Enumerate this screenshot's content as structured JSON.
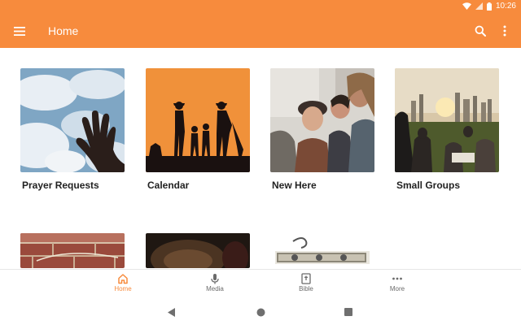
{
  "status_bar": {
    "time": "10:26",
    "icons": [
      "wifi-icon",
      "signal-icon",
      "battery-icon"
    ]
  },
  "app_bar": {
    "title": "Home",
    "left_icon": "hamburger-menu-icon",
    "right_icons": [
      "search-icon",
      "more-vertical-icon"
    ],
    "color": "#f78b3d"
  },
  "grid": {
    "tiles": [
      {
        "label": "Prayer Requests",
        "image": "sky-hand-photo"
      },
      {
        "label": "Calendar",
        "image": "family-silhouette-sunset-photo"
      },
      {
        "label": "New Here",
        "image": "friends-laughing-photo"
      },
      {
        "label": "Small Groups",
        "image": "city-picnic-sunset-photo"
      }
    ],
    "partial_row": [
      {
        "image": "brick-wall-photo"
      },
      {
        "image": "dark-texture-photo"
      },
      {
        "image": "four-ridge-logo"
      }
    ]
  },
  "bottom_nav": {
    "items": [
      {
        "label": "Home",
        "icon": "home-icon",
        "active": true
      },
      {
        "label": "Media",
        "icon": "microphone-icon",
        "active": false
      },
      {
        "label": "Bible",
        "icon": "bible-icon",
        "active": false
      },
      {
        "label": "More",
        "icon": "more-horizontal-icon",
        "active": false
      }
    ],
    "active_color": "#f78b3d"
  },
  "system_nav": {
    "buttons": [
      "back-icon",
      "home-circle-icon",
      "recents-icon"
    ]
  }
}
